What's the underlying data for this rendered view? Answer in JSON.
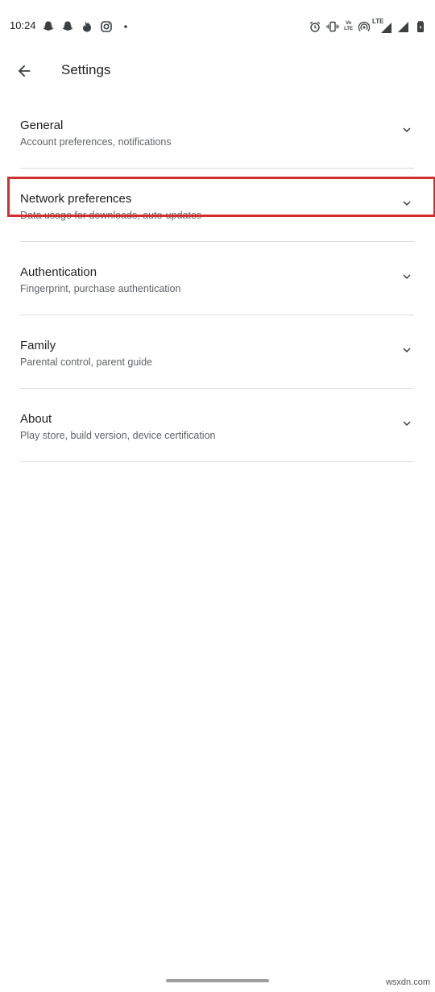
{
  "status_bar": {
    "time": "10:24",
    "left_icons": [
      "snapchat-icon",
      "snapchat-icon",
      "tinder-icon",
      "instagram-icon",
      "dot-icon"
    ],
    "right_icons": [
      "alarm-icon",
      "vibrate-icon",
      "volte-icon",
      "hotspot-icon",
      "lte-signal-icon",
      "signal-icon",
      "battery-icon"
    ],
    "volte_top": "Vo",
    "volte_bottom": "LTE",
    "lte_label": "LTE"
  },
  "app_bar": {
    "back_icon": "arrow-back-icon",
    "title": "Settings"
  },
  "settings": {
    "items": [
      {
        "title": "General",
        "subtitle": "Account preferences, notifications"
      },
      {
        "title": "Network preferences",
        "subtitle": "Data usage for downloads, auto-updates"
      },
      {
        "title": "Authentication",
        "subtitle": "Fingerprint, purchase authentication"
      },
      {
        "title": "Family",
        "subtitle": "Parental control, parent guide"
      },
      {
        "title": "About",
        "subtitle": "Play store, build version, device certification"
      }
    ],
    "expand_icon": "chevron-down-icon"
  },
  "highlight": {
    "color": "#d32f2f",
    "target": "Network preferences"
  },
  "colors": {
    "text_primary": "#202124",
    "text_secondary": "#5f6368",
    "divider": "#dadce0"
  },
  "watermark": "wsxdn.com"
}
